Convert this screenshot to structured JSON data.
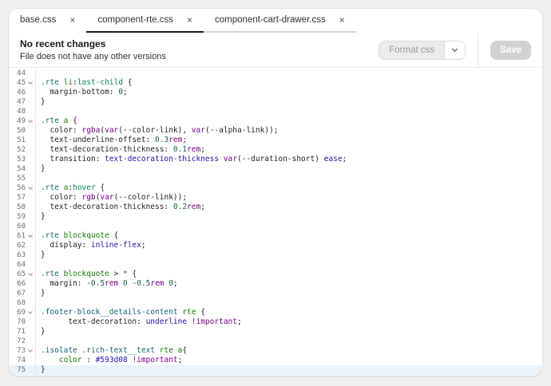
{
  "ui": {
    "close_glyph": "×"
  },
  "tabs": [
    {
      "label": "base.css",
      "active": false
    },
    {
      "label": "component-rte.css",
      "active": true
    },
    {
      "label": "component-cart-drawer.css",
      "active": false
    }
  ],
  "toolbar": {
    "title": "No recent changes",
    "subtitle": "File does not have any other versions",
    "format_button_label": "Format css",
    "save_label": "Save"
  },
  "editor": {
    "active_line": 75,
    "colors": {
      "default": "#1c1f23",
      "cls": "#116677",
      "tag": "#117a00",
      "psu": "#008855",
      "val": "#2211aa",
      "num": "#116644",
      "unit": "#770088",
      "kw": "#770088",
      "hex": "#2211aa",
      "activeline": "#e9f3fb"
    },
    "lines": [
      {
        "num": 44,
        "tokens": []
      },
      {
        "num": 45,
        "fold": true,
        "tokens": [
          {
            "t": ".rte",
            "c": "cls"
          },
          {
            "t": " "
          },
          {
            "t": "li",
            "c": "tag"
          },
          {
            "t": ":"
          },
          {
            "t": "last-child",
            "c": "psu"
          },
          {
            "t": " {"
          }
        ]
      },
      {
        "num": 46,
        "tokens": [
          {
            "t": "  margin-bottom: "
          },
          {
            "t": "0",
            "c": "num"
          },
          {
            "t": ";"
          }
        ]
      },
      {
        "num": 47,
        "tokens": [
          {
            "t": "}"
          }
        ]
      },
      {
        "num": 48,
        "tokens": []
      },
      {
        "num": 49,
        "fold": true,
        "tokens": [
          {
            "t": ".rte",
            "c": "cls"
          },
          {
            "t": " "
          },
          {
            "t": "a",
            "c": "tag"
          },
          {
            "t": " {"
          }
        ]
      },
      {
        "num": 50,
        "tokens": [
          {
            "t": "  color: "
          },
          {
            "t": "rgba",
            "c": "kw"
          },
          {
            "t": "("
          },
          {
            "t": "var",
            "c": "kw"
          },
          {
            "t": "(--color-link), "
          },
          {
            "t": "var",
            "c": "kw"
          },
          {
            "t": "(--alpha-link));"
          }
        ]
      },
      {
        "num": 51,
        "tokens": [
          {
            "t": "  text-underline-offset: "
          },
          {
            "t": "0.3",
            "c": "num"
          },
          {
            "t": "rem",
            "c": "unit"
          },
          {
            "t": ";"
          }
        ]
      },
      {
        "num": 52,
        "tokens": [
          {
            "t": "  text-decoration-thickness: "
          },
          {
            "t": "0.1",
            "c": "num"
          },
          {
            "t": "rem",
            "c": "unit"
          },
          {
            "t": ";"
          }
        ]
      },
      {
        "num": 53,
        "tokens": [
          {
            "t": "  transition: "
          },
          {
            "t": "text-decoration-thickness",
            "c": "val"
          },
          {
            "t": " "
          },
          {
            "t": "var",
            "c": "kw"
          },
          {
            "t": "(--duration-short) "
          },
          {
            "t": "ease",
            "c": "val"
          },
          {
            "t": ";"
          }
        ]
      },
      {
        "num": 54,
        "tokens": [
          {
            "t": "}"
          }
        ]
      },
      {
        "num": 55,
        "tokens": []
      },
      {
        "num": 56,
        "fold": true,
        "tokens": [
          {
            "t": ".rte",
            "c": "cls"
          },
          {
            "t": " "
          },
          {
            "t": "a",
            "c": "tag"
          },
          {
            "t": ":"
          },
          {
            "t": "hover",
            "c": "psu"
          },
          {
            "t": " {"
          }
        ]
      },
      {
        "num": 57,
        "tokens": [
          {
            "t": "  color: "
          },
          {
            "t": "rgb",
            "c": "kw"
          },
          {
            "t": "("
          },
          {
            "t": "var",
            "c": "kw"
          },
          {
            "t": "(--color-link));"
          }
        ]
      },
      {
        "num": 58,
        "tokens": [
          {
            "t": "  text-decoration-thickness: "
          },
          {
            "t": "0.2",
            "c": "num"
          },
          {
            "t": "rem",
            "c": "unit"
          },
          {
            "t": ";"
          }
        ]
      },
      {
        "num": 59,
        "tokens": [
          {
            "t": "}"
          }
        ]
      },
      {
        "num": 60,
        "tokens": []
      },
      {
        "num": 61,
        "fold": true,
        "tokens": [
          {
            "t": ".rte",
            "c": "cls"
          },
          {
            "t": " "
          },
          {
            "t": "blockquote",
            "c": "tag"
          },
          {
            "t": " {"
          }
        ]
      },
      {
        "num": 62,
        "tokens": [
          {
            "t": "  display: "
          },
          {
            "t": "inline-flex",
            "c": "val"
          },
          {
            "t": ";"
          }
        ]
      },
      {
        "num": 63,
        "tokens": [
          {
            "t": "}"
          }
        ]
      },
      {
        "num": 64,
        "tokens": []
      },
      {
        "num": 65,
        "fold": true,
        "tokens": [
          {
            "t": ".rte",
            "c": "cls"
          },
          {
            "t": " "
          },
          {
            "t": "blockquote",
            "c": "tag"
          },
          {
            "t": " > "
          },
          {
            "t": "*",
            "c": "tag"
          },
          {
            "t": " {"
          }
        ]
      },
      {
        "num": 66,
        "tokens": [
          {
            "t": "  margin: "
          },
          {
            "t": "-0.5",
            "c": "num"
          },
          {
            "t": "rem",
            "c": "unit"
          },
          {
            "t": " "
          },
          {
            "t": "0",
            "c": "num"
          },
          {
            "t": " "
          },
          {
            "t": "-0.5",
            "c": "num"
          },
          {
            "t": "rem",
            "c": "unit"
          },
          {
            "t": " "
          },
          {
            "t": "0",
            "c": "num"
          },
          {
            "t": ";"
          }
        ]
      },
      {
        "num": 67,
        "tokens": [
          {
            "t": "}"
          }
        ]
      },
      {
        "num": 68,
        "tokens": []
      },
      {
        "num": 69,
        "fold": true,
        "tokens": [
          {
            "t": ".footer-block__details-content",
            "c": "cls"
          },
          {
            "t": " "
          },
          {
            "t": "rte",
            "c": "tag"
          },
          {
            "t": " {"
          }
        ]
      },
      {
        "num": 70,
        "tokens": [
          {
            "t": "      text-decoration: "
          },
          {
            "t": "underline",
            "c": "val"
          },
          {
            "t": " "
          },
          {
            "t": "!important",
            "c": "kw"
          },
          {
            "t": ";"
          }
        ]
      },
      {
        "num": 71,
        "tokens": [
          {
            "t": "}"
          }
        ]
      },
      {
        "num": 72,
        "tokens": []
      },
      {
        "num": 73,
        "fold": true,
        "tokens": [
          {
            "t": ".isolate",
            "c": "cls"
          },
          {
            "t": " "
          },
          {
            "t": ".rich-text__text",
            "c": "cls"
          },
          {
            "t": " "
          },
          {
            "t": "rte",
            "c": "tag"
          },
          {
            "t": " "
          },
          {
            "t": "a",
            "c": "tag"
          },
          {
            "t": "{"
          }
        ]
      },
      {
        "num": 74,
        "tokens": [
          {
            "t": "    "
          },
          {
            "t": "color",
            "c": "tag"
          },
          {
            "t": " : "
          },
          {
            "t": "#593d08",
            "c": "hex"
          },
          {
            "t": " "
          },
          {
            "t": "!important",
            "c": "kw"
          },
          {
            "t": ";"
          }
        ]
      },
      {
        "num": 75,
        "tokens": [
          {
            "t": "}"
          }
        ]
      }
    ]
  }
}
